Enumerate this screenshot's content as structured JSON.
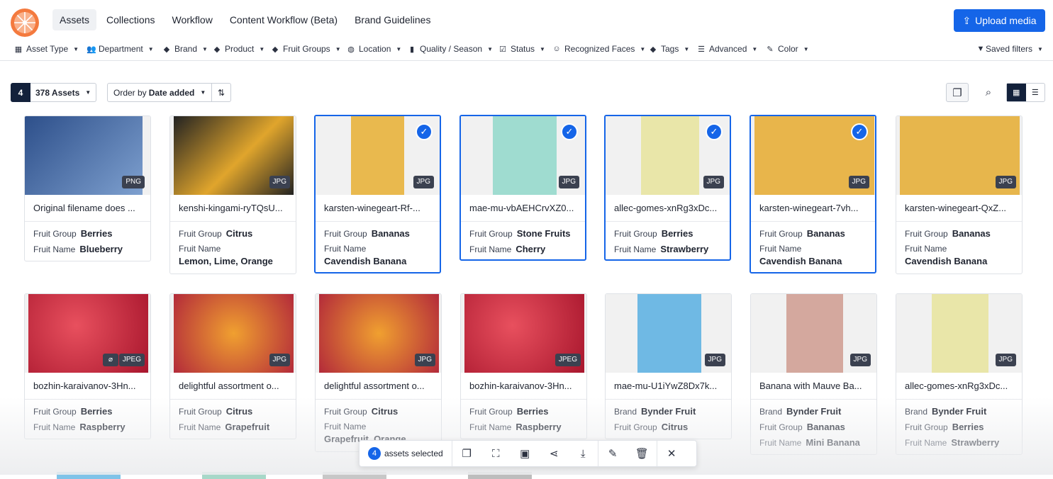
{
  "nav": {
    "tabs": [
      {
        "label": "Assets",
        "active": true
      },
      {
        "label": "Collections"
      },
      {
        "label": "Workflow"
      },
      {
        "label": "Content Workflow (Beta)"
      },
      {
        "label": "Brand Guidelines"
      }
    ],
    "upload_label": "Upload media",
    "accent": "#1565e8"
  },
  "filters": {
    "items": [
      "Asset Type",
      "Department",
      "Brand",
      "Product",
      "Fruit Groups",
      "Location",
      "Quality / Season",
      "Status",
      "Recognized Faces",
      "Tags",
      "Advanced",
      "Color"
    ],
    "saved": "Saved filters"
  },
  "toolbar": {
    "selected_count": "4",
    "assets_count": "378 Assets",
    "order_prefix": "Order by",
    "order_value": "Date added"
  },
  "cards": [
    {
      "name": "Original filename does ...",
      "format": "PNG",
      "selected": false,
      "meta": [
        {
          "k": "Fruit Group",
          "v": "Berries"
        },
        {
          "k": "Fruit Name",
          "v": "Blueberry"
        }
      ]
    },
    {
      "name": "kenshi-kingami-ryTQsU...",
      "format": "JPG",
      "selected": false,
      "meta": [
        {
          "k": "Fruit Group",
          "v": "Citrus"
        },
        {
          "k": "Fruit Name",
          "v": "Lemon, Lime, Orange",
          "stack": true
        }
      ]
    },
    {
      "name": "karsten-winegeart-Rf-...",
      "format": "JPG",
      "selected": true,
      "meta": [
        {
          "k": "Fruit Group",
          "v": "Bananas"
        },
        {
          "k": "Fruit Name",
          "v": "Cavendish Banana",
          "stack": true
        }
      ]
    },
    {
      "name": "mae-mu-vbAEHCrvXZ0...",
      "format": "JPG",
      "selected": true,
      "meta": [
        {
          "k": "Fruit Group",
          "v": "Stone Fruits"
        },
        {
          "k": "Fruit Name",
          "v": "Cherry"
        }
      ]
    },
    {
      "name": "allec-gomes-xnRg3xDc...",
      "format": "JPG",
      "selected": true,
      "meta": [
        {
          "k": "Fruit Group",
          "v": "Berries"
        },
        {
          "k": "Fruit Name",
          "v": "Strawberry"
        }
      ]
    },
    {
      "name": "karsten-winegeart-7vh...",
      "format": "JPG",
      "selected": true,
      "meta": [
        {
          "k": "Fruit Group",
          "v": "Bananas"
        },
        {
          "k": "Fruit Name",
          "v": "Cavendish Banana",
          "stack": true
        }
      ]
    },
    {
      "name": "karsten-winegeart-QxZ...",
      "format": "JPG",
      "selected": false,
      "meta": [
        {
          "k": "Fruit Group",
          "v": "Bananas"
        },
        {
          "k": "Fruit Name",
          "v": "Cavendish Banana",
          "stack": true
        }
      ]
    },
    {
      "name": "bozhin-karaivanov-3Hn...",
      "format": "JPEG",
      "clip": true,
      "selected": false,
      "meta": [
        {
          "k": "Fruit Group",
          "v": "Berries"
        },
        {
          "k": "Fruit Name",
          "v": "Raspberry"
        }
      ]
    },
    {
      "name": "delightful assortment o...",
      "format": "JPG",
      "selected": false,
      "meta": [
        {
          "k": "Fruit Group",
          "v": "Citrus"
        },
        {
          "k": "Fruit Name",
          "v": "Grapefruit"
        }
      ]
    },
    {
      "name": "delightful assortment o...",
      "format": "JPG",
      "selected": false,
      "meta": [
        {
          "k": "Fruit Group",
          "v": "Citrus"
        },
        {
          "k": "Fruit Name",
          "v": "Grapefruit, Orange",
          "stack": true
        }
      ]
    },
    {
      "name": "bozhin-karaivanov-3Hn...",
      "format": "JPEG",
      "selected": false,
      "meta": [
        {
          "k": "Fruit Group",
          "v": "Berries"
        },
        {
          "k": "Fruit Name",
          "v": "Raspberry"
        }
      ]
    },
    {
      "name": "mae-mu-U1iYwZ8Dx7k...",
      "format": "JPG",
      "selected": false,
      "meta": [
        {
          "k": "Brand",
          "v": "Bynder Fruit"
        },
        {
          "k": "Fruit Group",
          "v": "Citrus"
        }
      ]
    },
    {
      "name": "Banana with Mauve Ba...",
      "format": "JPG",
      "selected": false,
      "meta": [
        {
          "k": "Brand",
          "v": "Bynder Fruit"
        },
        {
          "k": "Fruit Group",
          "v": "Bananas"
        },
        {
          "k": "Fruit Name",
          "v": "Mini Banana"
        }
      ]
    },
    {
      "name": "allec-gomes-xnRg3xDc...",
      "format": "JPG",
      "selected": false,
      "meta": [
        {
          "k": "Brand",
          "v": "Bynder Fruit"
        },
        {
          "k": "Fruit Group",
          "v": "Berries"
        },
        {
          "k": "Fruit Name",
          "v": "Strawberry"
        }
      ]
    }
  ],
  "selection_bar": {
    "count": "4",
    "label": "assets selected"
  }
}
